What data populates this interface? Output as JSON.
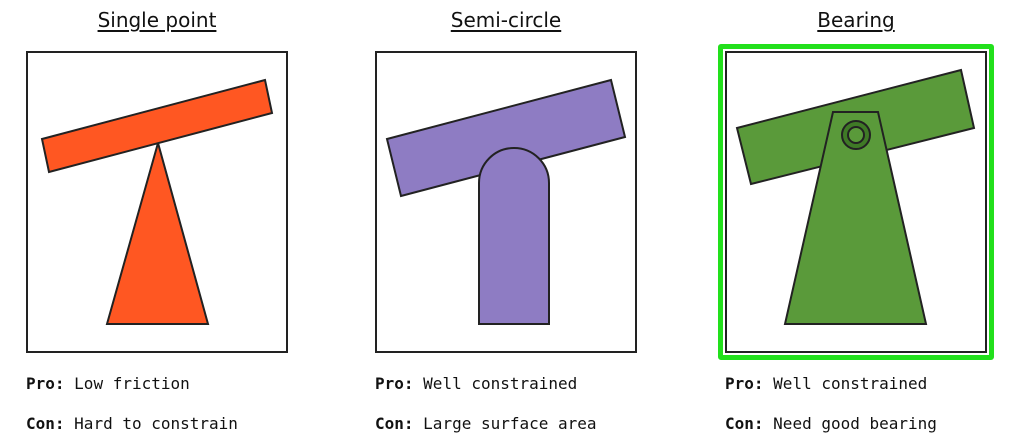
{
  "columns": [
    {
      "title": "Single point",
      "pro_label": "Pro:",
      "pro_text": "Low friction",
      "con_label": "Con:",
      "con_text": "Hard to constrain",
      "color": "#ff5722",
      "selected": false
    },
    {
      "title": "Semi-circle",
      "pro_label": "Pro:",
      "pro_text": "Well constrained",
      "con_label": "Con:",
      "con_text": "Large surface area",
      "color": "#8e7cc3",
      "selected": false
    },
    {
      "title": "Bearing",
      "pro_label": "Pro:",
      "pro_text": "Well constrained",
      "con_label": "Con:",
      "con_text": "Need good bearing",
      "color": "#5a9a3a",
      "selected": true,
      "highlight_color": "#22e01c"
    }
  ]
}
